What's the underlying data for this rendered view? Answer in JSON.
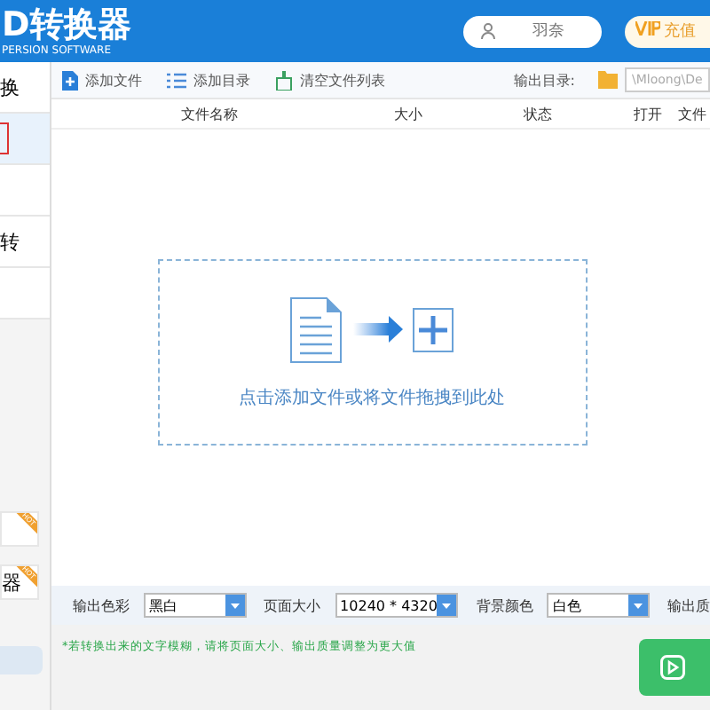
{
  "header": {
    "title": "D转换器",
    "subtitle": "PERSION SOFTWARE",
    "user": "羽奈",
    "vip": "充值"
  },
  "sidebar": {
    "items": [
      {
        "label": "换",
        "selected": false
      },
      {
        "selected": true
      },
      {
        "selected": false
      },
      {
        "label": "转",
        "selected": false
      },
      {
        "selected": false
      }
    ],
    "promos": [
      {
        "badge": "HOT"
      },
      {
        "label": "器",
        "badge": "HOT"
      }
    ]
  },
  "toolbar": {
    "buttons": [
      {
        "kind": "add-file",
        "label": "添加文件"
      },
      {
        "kind": "add-folder",
        "label": "添加目录"
      },
      {
        "kind": "clear",
        "label": "清空文件列表"
      }
    ],
    "output_label": "输出目录:",
    "output_path": "\\Mloong\\De"
  },
  "table": {
    "columns": [
      "文件名称",
      "大小",
      "状态",
      "打开",
      "文件"
    ]
  },
  "dropzone": {
    "text": "点击添加文件或将文件拖拽到此处"
  },
  "settings": [
    {
      "label": "输出色彩",
      "value": "黑白"
    },
    {
      "label": "页面大小",
      "value": "10240 * 4320"
    },
    {
      "label": "背景颜色",
      "value": "白色"
    },
    {
      "label": "输出质"
    }
  ],
  "hint": "*若转换出来的文字模糊，请将页面大小、输出质量调整为更大值"
}
